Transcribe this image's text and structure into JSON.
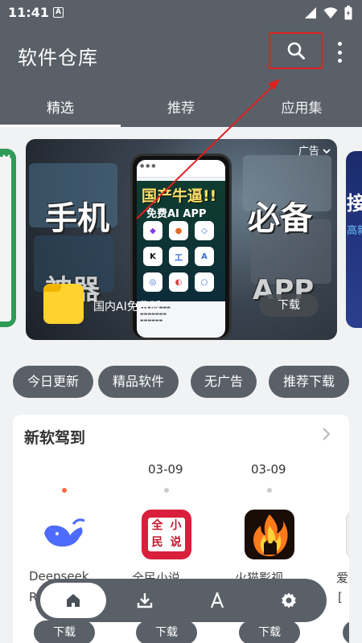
{
  "status_bar": {
    "time": "11:41",
    "notification_letter": "A"
  },
  "header": {
    "title": "软件仓库",
    "search_icon": "search-icon",
    "more_icon": "more-vertical-icon"
  },
  "tabs": [
    {
      "label": "精选",
      "active": true
    },
    {
      "label": "推荐",
      "active": false
    },
    {
      "label": "应用集",
      "active": false
    }
  ],
  "banner": {
    "ad_label": "广告",
    "headline_left": "手机",
    "headline_right": "必备",
    "subline_left": "神器",
    "subline_right": "APP",
    "phone_title": "国产牛逼!!",
    "phone_subtitle": "免费AI APP",
    "app_name": "国内AI免费版",
    "download_label": "下载",
    "right_peek_text": "接",
    "right_peek_sub": "高新"
  },
  "chips": [
    "今日更新",
    "精品软件",
    "无广告",
    "推荐下载"
  ],
  "new_software": {
    "title": "新软驾到",
    "dates": [
      "03-09",
      "03-09"
    ],
    "apps": [
      {
        "name": "Deepseek",
        "name_line2": "R",
        "icon": "whale-icon",
        "download": "下载"
      },
      {
        "name": "全民小说",
        "icon": "book-icon",
        "download": "下载"
      },
      {
        "name": "火猫影视",
        "icon": "fire-cat-icon",
        "download": "下载"
      },
      {
        "name": "爱",
        "name_line2": "[",
        "icon": "partial-app-icon",
        "download": "下载"
      }
    ]
  },
  "bottom_nav": [
    {
      "name": "home",
      "icon": "home-icon",
      "active": true
    },
    {
      "name": "download",
      "icon": "download-icon",
      "active": false
    },
    {
      "name": "apps",
      "icon": "compass-icon",
      "active": false
    },
    {
      "name": "settings",
      "icon": "gear-icon",
      "active": false
    }
  ],
  "colors": {
    "header_bg": "#5a6068",
    "annotation": "#e02020",
    "active_dot": "#ff6a3d"
  }
}
